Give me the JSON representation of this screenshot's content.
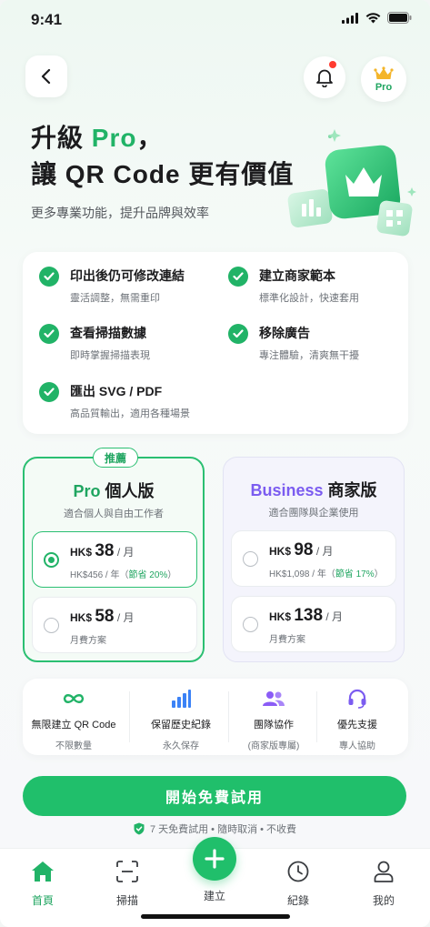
{
  "status_bar": {
    "time": "9:41"
  },
  "header": {
    "pro_badge_label": "Pro"
  },
  "hero": {
    "title_line1_prefix": "升級 ",
    "title_line1_highlight": "Pro",
    "title_line1_suffix": "，",
    "title_line2": "讓 QR Code 更有價值",
    "subtitle": "更多專業功能，提升品牌與效率"
  },
  "features": [
    {
      "title": "印出後仍可修改連結",
      "desc": "靈活調整，無需重印"
    },
    {
      "title": "建立商家範本",
      "desc": "標準化設計，快速套用"
    },
    {
      "title": "查看掃描數據",
      "desc": "即時掌握掃描表現"
    },
    {
      "title": "移除廣告",
      "desc": "專注體驗，清爽無干擾"
    },
    {
      "title": "匯出 SVG / PDF",
      "desc": "高品質輸出，適用各種場景"
    }
  ],
  "plans": {
    "pro": {
      "badge": "推薦",
      "name_en": "Pro",
      "name_zh": " 個人版",
      "desc": "適合個人與自由工作者",
      "yearly": {
        "currency": "HK$ ",
        "amount": "38",
        "per": " / 月",
        "sub": "HK$456 / 年（",
        "save": "節省 20%",
        "sub_end": "）",
        "selected": true
      },
      "monthly": {
        "currency": "HK$ ",
        "amount": "58",
        "per": " / 月",
        "sub": "月費方案",
        "selected": false
      }
    },
    "business": {
      "name_en": "Business",
      "name_zh": " 商家版",
      "desc": "適合團隊與企業使用",
      "yearly": {
        "currency": "HK$ ",
        "amount": "98",
        "per": " / 月",
        "sub": "HK$1,098 / 年（",
        "save": "節省 17%",
        "sub_end": "）",
        "selected": false
      },
      "monthly": {
        "currency": "HK$ ",
        "amount": "138",
        "per": " / 月",
        "sub": "月費方案",
        "selected": false
      }
    }
  },
  "perks": [
    {
      "icon": "infinity-icon",
      "title": "無限建立 QR Code",
      "desc": "不限數量"
    },
    {
      "icon": "bar-chart-icon",
      "title": "保留歷史紀錄",
      "desc": "永久保存"
    },
    {
      "icon": "team-icon",
      "title": "團隊協作",
      "desc": "(商家版專屬)"
    },
    {
      "icon": "headset-icon",
      "title": "優先支援",
      "desc": "專人協助"
    }
  ],
  "cta": {
    "label": "開始免費試用"
  },
  "trial_note": "7 天免費試用 • 隨時取消 • 不收費",
  "tabs": [
    {
      "icon": "home-icon",
      "label": "首頁",
      "active": true
    },
    {
      "icon": "scan-icon",
      "label": "掃描",
      "active": false
    },
    {
      "icon": "plus-icon",
      "label": "建立",
      "active": false
    },
    {
      "icon": "clock-icon",
      "label": "紀錄",
      "active": false
    },
    {
      "icon": "user-icon",
      "label": "我的",
      "active": false
    }
  ],
  "colors": {
    "brand_green": "#20bf6b",
    "business_purple": "#7b5cf0",
    "notification_red": "#ff3b30"
  }
}
